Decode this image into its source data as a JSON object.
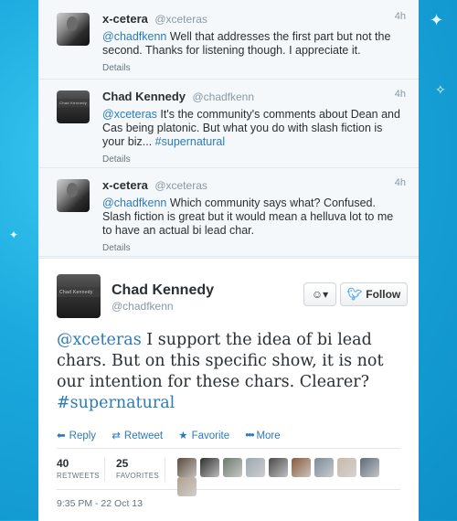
{
  "tweets": [
    {
      "name": "x-cetera",
      "handle": "@xceteras",
      "time": "4h",
      "mention": "@chadfkenn",
      "text": " Well that addresses the first part but not the second. Thanks for listening though. I appreciate it.",
      "details": "Details"
    },
    {
      "name": "Chad Kennedy",
      "handle": "@chadfkenn",
      "time": "4h",
      "mention": "@xceteras",
      "text": " It's the community's comments about Dean and Cas being platonic. But what you do with slash fiction is your biz... ",
      "hashtag": "#supernatural",
      "details": "Details"
    },
    {
      "name": "x-cetera",
      "handle": "@xceteras",
      "time": "4h",
      "mention": "@chadfkenn",
      "text": " Which community says what? Confused. Slash fiction is great but it would mean a helluva lot to me to have an actual bi lead char.",
      "details": "Details"
    }
  ],
  "main_tweet": {
    "name": "Chad Kennedy",
    "handle": "@chadfkenn",
    "mention": "@xceteras",
    "text": " I support the idea of bi lead chars. But on this specific show, it is not our intention for these chars. Clearer? ",
    "hashtag": "#supernatural",
    "follow_label": "Follow",
    "user_dropdown_label": "▾",
    "actions": {
      "reply": "Reply",
      "retweet": "Retweet",
      "favorite": "Favorite",
      "more": "More"
    },
    "stats": {
      "retweets_count": "40",
      "retweets_label": "RETWEETS",
      "favorites_count": "25",
      "favorites_label": "FAVORITES"
    },
    "favoriter_colors": [
      "#5a4a3a",
      "#2f2f2f",
      "#6c7a6c",
      "#9aa7b0",
      "#4a4a4a",
      "#8a5a3a",
      "#7a8a9a",
      "#c9b9a9",
      "#5a6a7a",
      "#b0a090"
    ],
    "timestamp": "9:35 PM - 22 Oct 13"
  },
  "avatar_text": "Chad Kennedy",
  "colors": {
    "link": "#2b7bb9",
    "background": "#1aa8dd"
  }
}
